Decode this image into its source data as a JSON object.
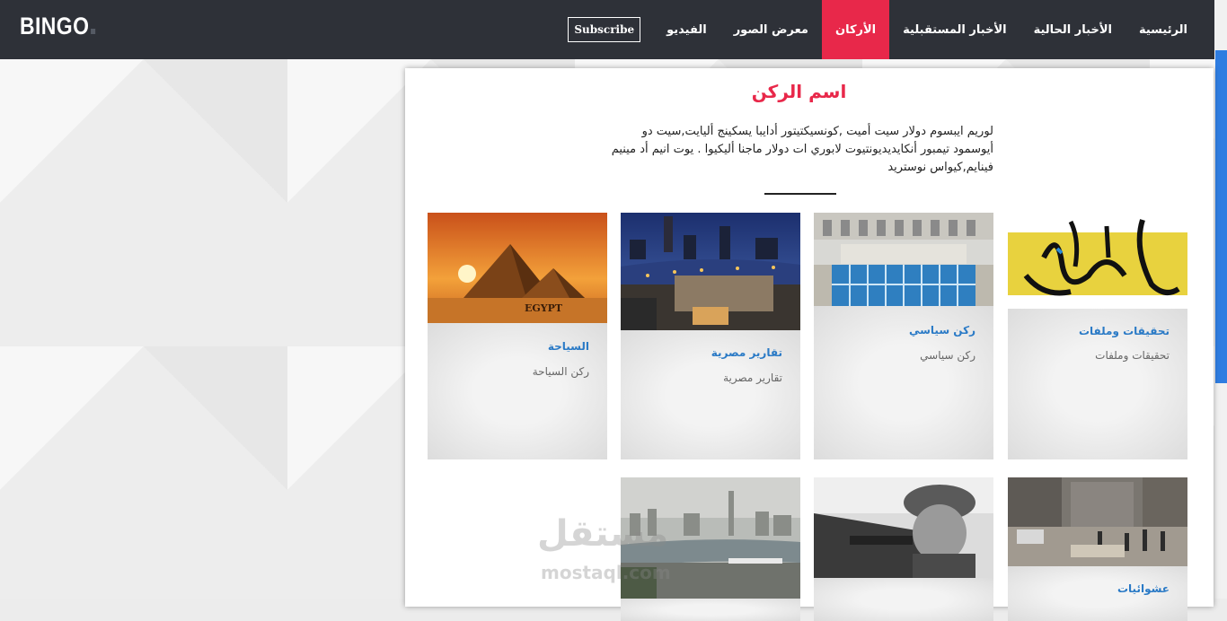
{
  "brand": {
    "name": "BINGO"
  },
  "nav": {
    "items": [
      {
        "label": "الرئيسية",
        "active": false
      },
      {
        "label": "الأخبار الحالية",
        "active": false
      },
      {
        "label": "الأخبار المستقبلية",
        "active": false
      },
      {
        "label": "الأركان",
        "active": true
      },
      {
        "label": "معرض الصور",
        "active": false
      },
      {
        "label": "الفيديو",
        "active": false
      }
    ],
    "subscribe_label": "Subscribe"
  },
  "section": {
    "title": "اسم الركن",
    "description": "لوريم ايبسوم دولار سيت أميت ,كونسيكتيتور أدايبا يسكينج أليايت,سيت دو أيوسمود تيمبور أنكايديديونتيوت لابوري ات دولار ماجنا أليكيوا . يوت انيم أد مينيم فينايم,كيواس نوستريد"
  },
  "cards": [
    {
      "title": "تحقيقات وملفات",
      "subtitle": "تحقيقات وملفات",
      "image": "calligraphy-image"
    },
    {
      "title": "ركن سياسي",
      "subtitle": "ركن سياسي",
      "image": "building-image"
    },
    {
      "title": "تقارير مصرية",
      "subtitle": "تقارير مصرية",
      "image": "nile-night-image"
    },
    {
      "title": "السياحة",
      "subtitle": "ركن السياحة",
      "image": "pyramids-image"
    },
    {
      "title": "عشوائيات",
      "subtitle": "",
      "image": "street-image"
    },
    {
      "title": "",
      "subtitle": "",
      "image": "soldier-image"
    },
    {
      "title": "",
      "subtitle": "",
      "image": "city-river-image"
    }
  ],
  "images": {
    "pyramids_caption": "EGYPT"
  },
  "watermark": {
    "ar": "مستقل",
    "en": "mostaql.com"
  },
  "colors": {
    "accent": "#e8284a",
    "navbar": "#2e3138",
    "link": "#2a7ac6",
    "scrollbar": "#2f7de1"
  }
}
